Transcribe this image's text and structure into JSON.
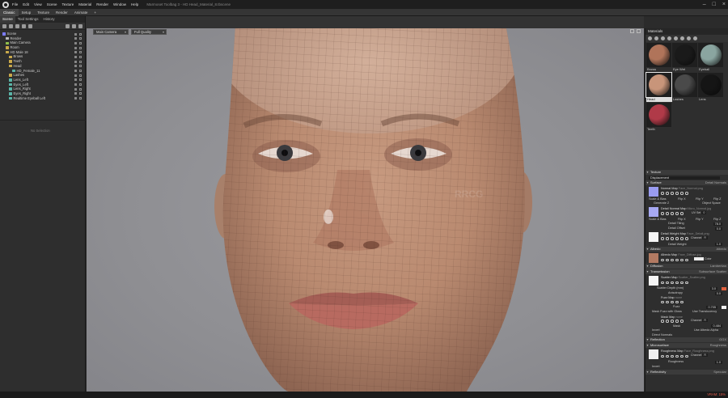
{
  "app": {
    "title": "Marmoset Toolbag 3 - HD Head_Material_8.tbscene",
    "menu": [
      "File",
      "Edit",
      "View",
      "Scene",
      "Texture",
      "Material",
      "Render",
      "Window",
      "Help"
    ],
    "logo_icon": "marmoset-logo-icon"
  },
  "workspace_tabs": [
    "Classic",
    "Setup",
    "Texture",
    "Render",
    "Animate",
    "+"
  ],
  "left_panel": {
    "tabs": [
      "Scene",
      "Tool Settings",
      "History"
    ],
    "tree": [
      {
        "label": "Scene",
        "depth": 0,
        "color": "#7c7cff"
      },
      {
        "label": "Render",
        "depth": 1,
        "color": "#bbbbbb"
      },
      {
        "label": "Main Camera",
        "depth": 1,
        "color": "#8fbf4a"
      },
      {
        "label": "Room",
        "depth": 1,
        "color": "#c9a94a"
      },
      {
        "label": "HD Male 18",
        "depth": 1,
        "color": "#c9a94a"
      },
      {
        "label": "Brows",
        "depth": 2,
        "color": "#c9a94a"
      },
      {
        "label": "Teeth",
        "depth": 2,
        "color": "#c9a94a"
      },
      {
        "label": "Head",
        "depth": 2,
        "color": "#c9a94a"
      },
      {
        "label": "HD_Female_11",
        "depth": 3,
        "color": "#5ab5a8"
      },
      {
        "label": "Lashes",
        "depth": 2,
        "color": "#c9a94a"
      },
      {
        "label": "Lens_Left",
        "depth": 2,
        "color": "#5ab5a8"
      },
      {
        "label": "Eyes_Left",
        "depth": 2,
        "color": "#5ab5a8"
      },
      {
        "label": "Lens_Right",
        "depth": 2,
        "color": "#5ab5a8"
      },
      {
        "label": "Eyes_Right",
        "depth": 2,
        "color": "#5ab5a8"
      },
      {
        "label": "Realtime Eyeball Left",
        "depth": 2,
        "color": "#5ab5a8"
      }
    ],
    "no_selection": "No Selection"
  },
  "viewport": {
    "camera": "Main Camera",
    "quality": "Full Quality",
    "watermark": "RRCG"
  },
  "materials_panel": {
    "header": "Materials",
    "materials": [
      {
        "name": "Brows",
        "swatch": "#b0745a",
        "selected": false
      },
      {
        "name": "Eye Wet",
        "swatch": "#1a1a1a",
        "selected": false
      },
      {
        "name": "Eyeball",
        "swatch": "#8aa5a0",
        "selected": false
      },
      {
        "name": "Head",
        "swatch": "#c8957a",
        "selected": true
      },
      {
        "name": "Lashes",
        "swatch": "#4a4a4a",
        "selected": false
      },
      {
        "name": "Lens",
        "swatch": "#151515",
        "selected": false
      },
      {
        "name": "Teeth",
        "swatch": "#b03a48",
        "selected": false
      }
    ],
    "sections": {
      "texture": "Texture",
      "displacement": "Displacement",
      "surface": {
        "title": "Surface",
        "value": "Detail Normals"
      },
      "normal_map": {
        "label": "Normal Map",
        "file": "Face_Normal.png"
      },
      "scale_bias": "Scale & Bias",
      "flip_x": "Flip X",
      "flip_y": "Flip Y",
      "flip_z": "Flip Z",
      "generate_z": "Generate Z",
      "object_space": "Object Space",
      "detail_normal_map": {
        "label": "Detail Normal Map",
        "file": "Micro_Normal.jpg"
      },
      "uv_set": "UV Set",
      "uv_set_value": "0",
      "detail_tiling": {
        "label": "Detail Tiling",
        "value": "78.0"
      },
      "detail_offset": {
        "label": "Detail Offset",
        "value": "0.0"
      },
      "detail_weight_map": {
        "label": "Detail Weight Map",
        "file": "Face_Detail.png"
      },
      "channel": "Channel",
      "channel_value": "R",
      "detail_weight": {
        "label": "Detail Weight",
        "value": "1.0"
      },
      "albedo": {
        "title": "Albedo",
        "value": "Albedo"
      },
      "albedo_map": {
        "label": "Albedo Map",
        "file": "Face_Diffuse.jpg"
      },
      "color": "Color",
      "diffusion": {
        "title": "Diffusion",
        "value": "Lambertian"
      },
      "transmission": {
        "title": "Transmission",
        "value": "Subsurface Scatter"
      },
      "scatter_map": {
        "label": "Scatter Map",
        "file": "Scatter_Scatter.png"
      },
      "scatter_depth": {
        "label": "Scatter Depth (mm)",
        "value": "3.0"
      },
      "anisotropy": {
        "label": "Anisotropy",
        "value": "0.0"
      },
      "fuzz_map": {
        "label": "Fuzz Map",
        "file": "none"
      },
      "fuzz": {
        "label": "Fuzz",
        "value": "0.705"
      },
      "mask_fuzz": "Mask Fuzz with Gloss",
      "use_translucency": "Use Translucency",
      "mask_map": {
        "label": "Mask Map",
        "file": "none"
      },
      "mask": {
        "label": "Mask",
        "value": "0.484"
      },
      "invert": "Invert",
      "use_albedo_alpha": "Use Albedo Alpha",
      "direct_normals": "Direct Normals",
      "reflection": {
        "title": "Reflection",
        "value": "GGX"
      },
      "microsurface": {
        "title": "Microsurface",
        "value": "Roughness"
      },
      "roughness_map": {
        "label": "Roughness Map",
        "file": "Face_Roughness.png"
      },
      "roughness": {
        "label": "Roughness",
        "value": "1.0"
      },
      "invert2": "Invert",
      "reflectivity": {
        "title": "Reflectivity",
        "value": "Specular"
      }
    }
  },
  "status": {
    "vram": "VRAM: 15%"
  },
  "colors": {
    "accent": "#d7e14a",
    "scatter_color": "#e0613e",
    "vram": "#e05a4a"
  }
}
